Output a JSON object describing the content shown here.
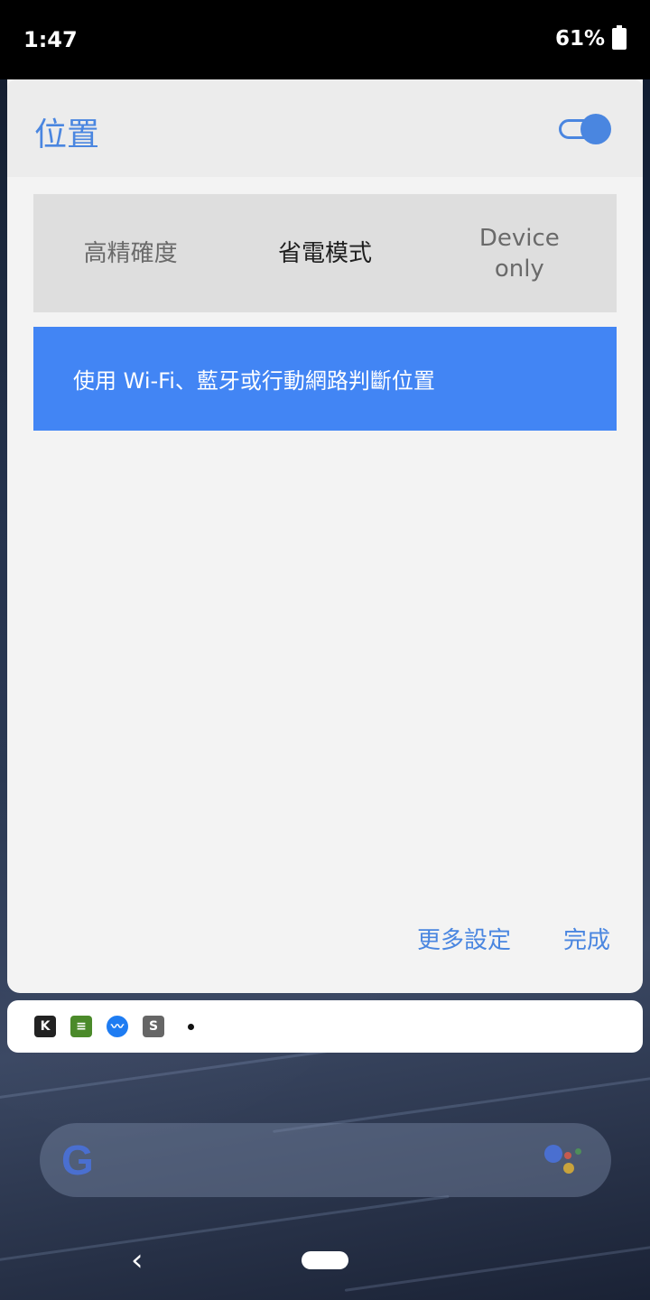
{
  "status_bar": {
    "time": "1:47",
    "battery": "61%"
  },
  "dialog": {
    "title": "位置",
    "toggle_on": true,
    "modes": [
      {
        "label": "高精確度",
        "selected": false
      },
      {
        "label": "省電模式",
        "selected": true
      },
      {
        "label": "Device only",
        "selected": false
      }
    ],
    "description": "使用 Wi-Fi、藍牙或行動網路判斷位置",
    "more_settings": "更多設定",
    "done": "完成"
  },
  "notification_icons": [
    "k-app-icon",
    "note-icon",
    "messenger-icon",
    "shop-icon"
  ],
  "colors": {
    "accent": "#4a86e0",
    "selected_mode_bg": "#4285f4"
  }
}
